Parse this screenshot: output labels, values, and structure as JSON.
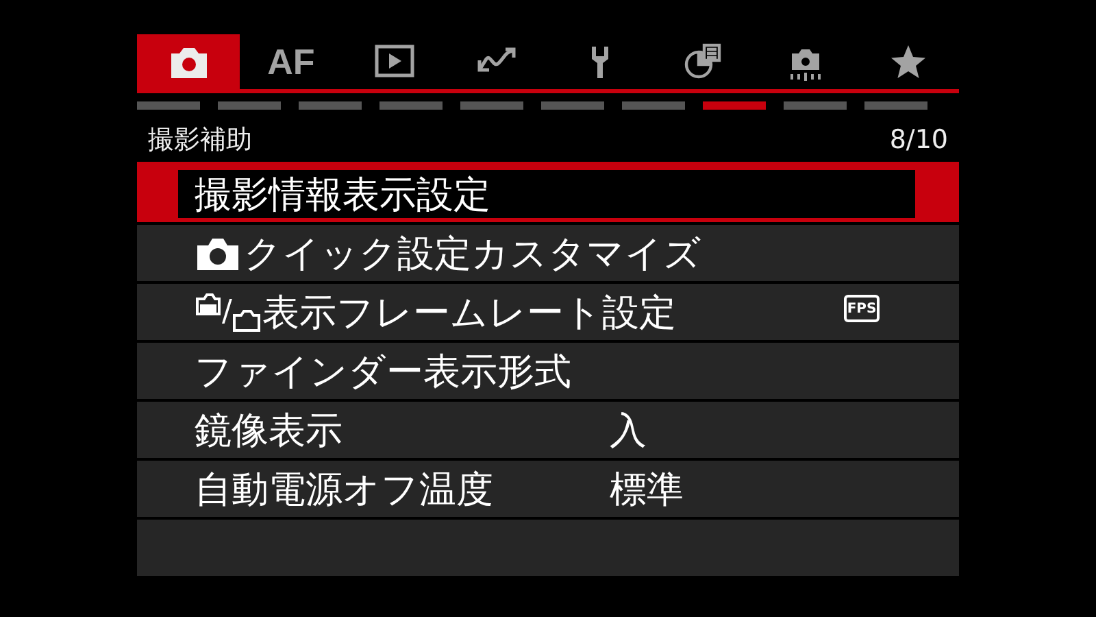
{
  "tabs": [
    {
      "selected": true
    },
    {
      "label": "AF",
      "selected": false
    },
    {
      "selected": false
    },
    {
      "selected": false
    },
    {
      "selected": false
    },
    {
      "selected": false
    },
    {
      "selected": false
    },
    {
      "selected": false
    }
  ],
  "page_indicators": [
    {
      "selected": false
    },
    {
      "selected": false
    },
    {
      "selected": false
    },
    {
      "selected": false
    },
    {
      "selected": false
    },
    {
      "selected": false
    },
    {
      "selected": false
    },
    {
      "selected": true
    },
    {
      "selected": false
    },
    {
      "selected": false
    }
  ],
  "header": {
    "title": "撮影補助",
    "page": "8/10"
  },
  "rows": [
    {
      "kind": "plain",
      "label": "撮影情報表示設定",
      "selected": true
    },
    {
      "kind": "camera",
      "label": "クイック設定カスタマイズ",
      "selected": false
    },
    {
      "kind": "dual",
      "separator": "/",
      "label": "表示フレームレート設定",
      "badge": "FPS",
      "selected": false
    },
    {
      "kind": "plain",
      "label": "ファインダー表示形式",
      "selected": false
    },
    {
      "kind": "plain",
      "label": "鏡像表示",
      "value": "入",
      "selected": false
    },
    {
      "kind": "plain",
      "label": "自動電源オフ温度",
      "value": "標準",
      "selected": false
    }
  ]
}
